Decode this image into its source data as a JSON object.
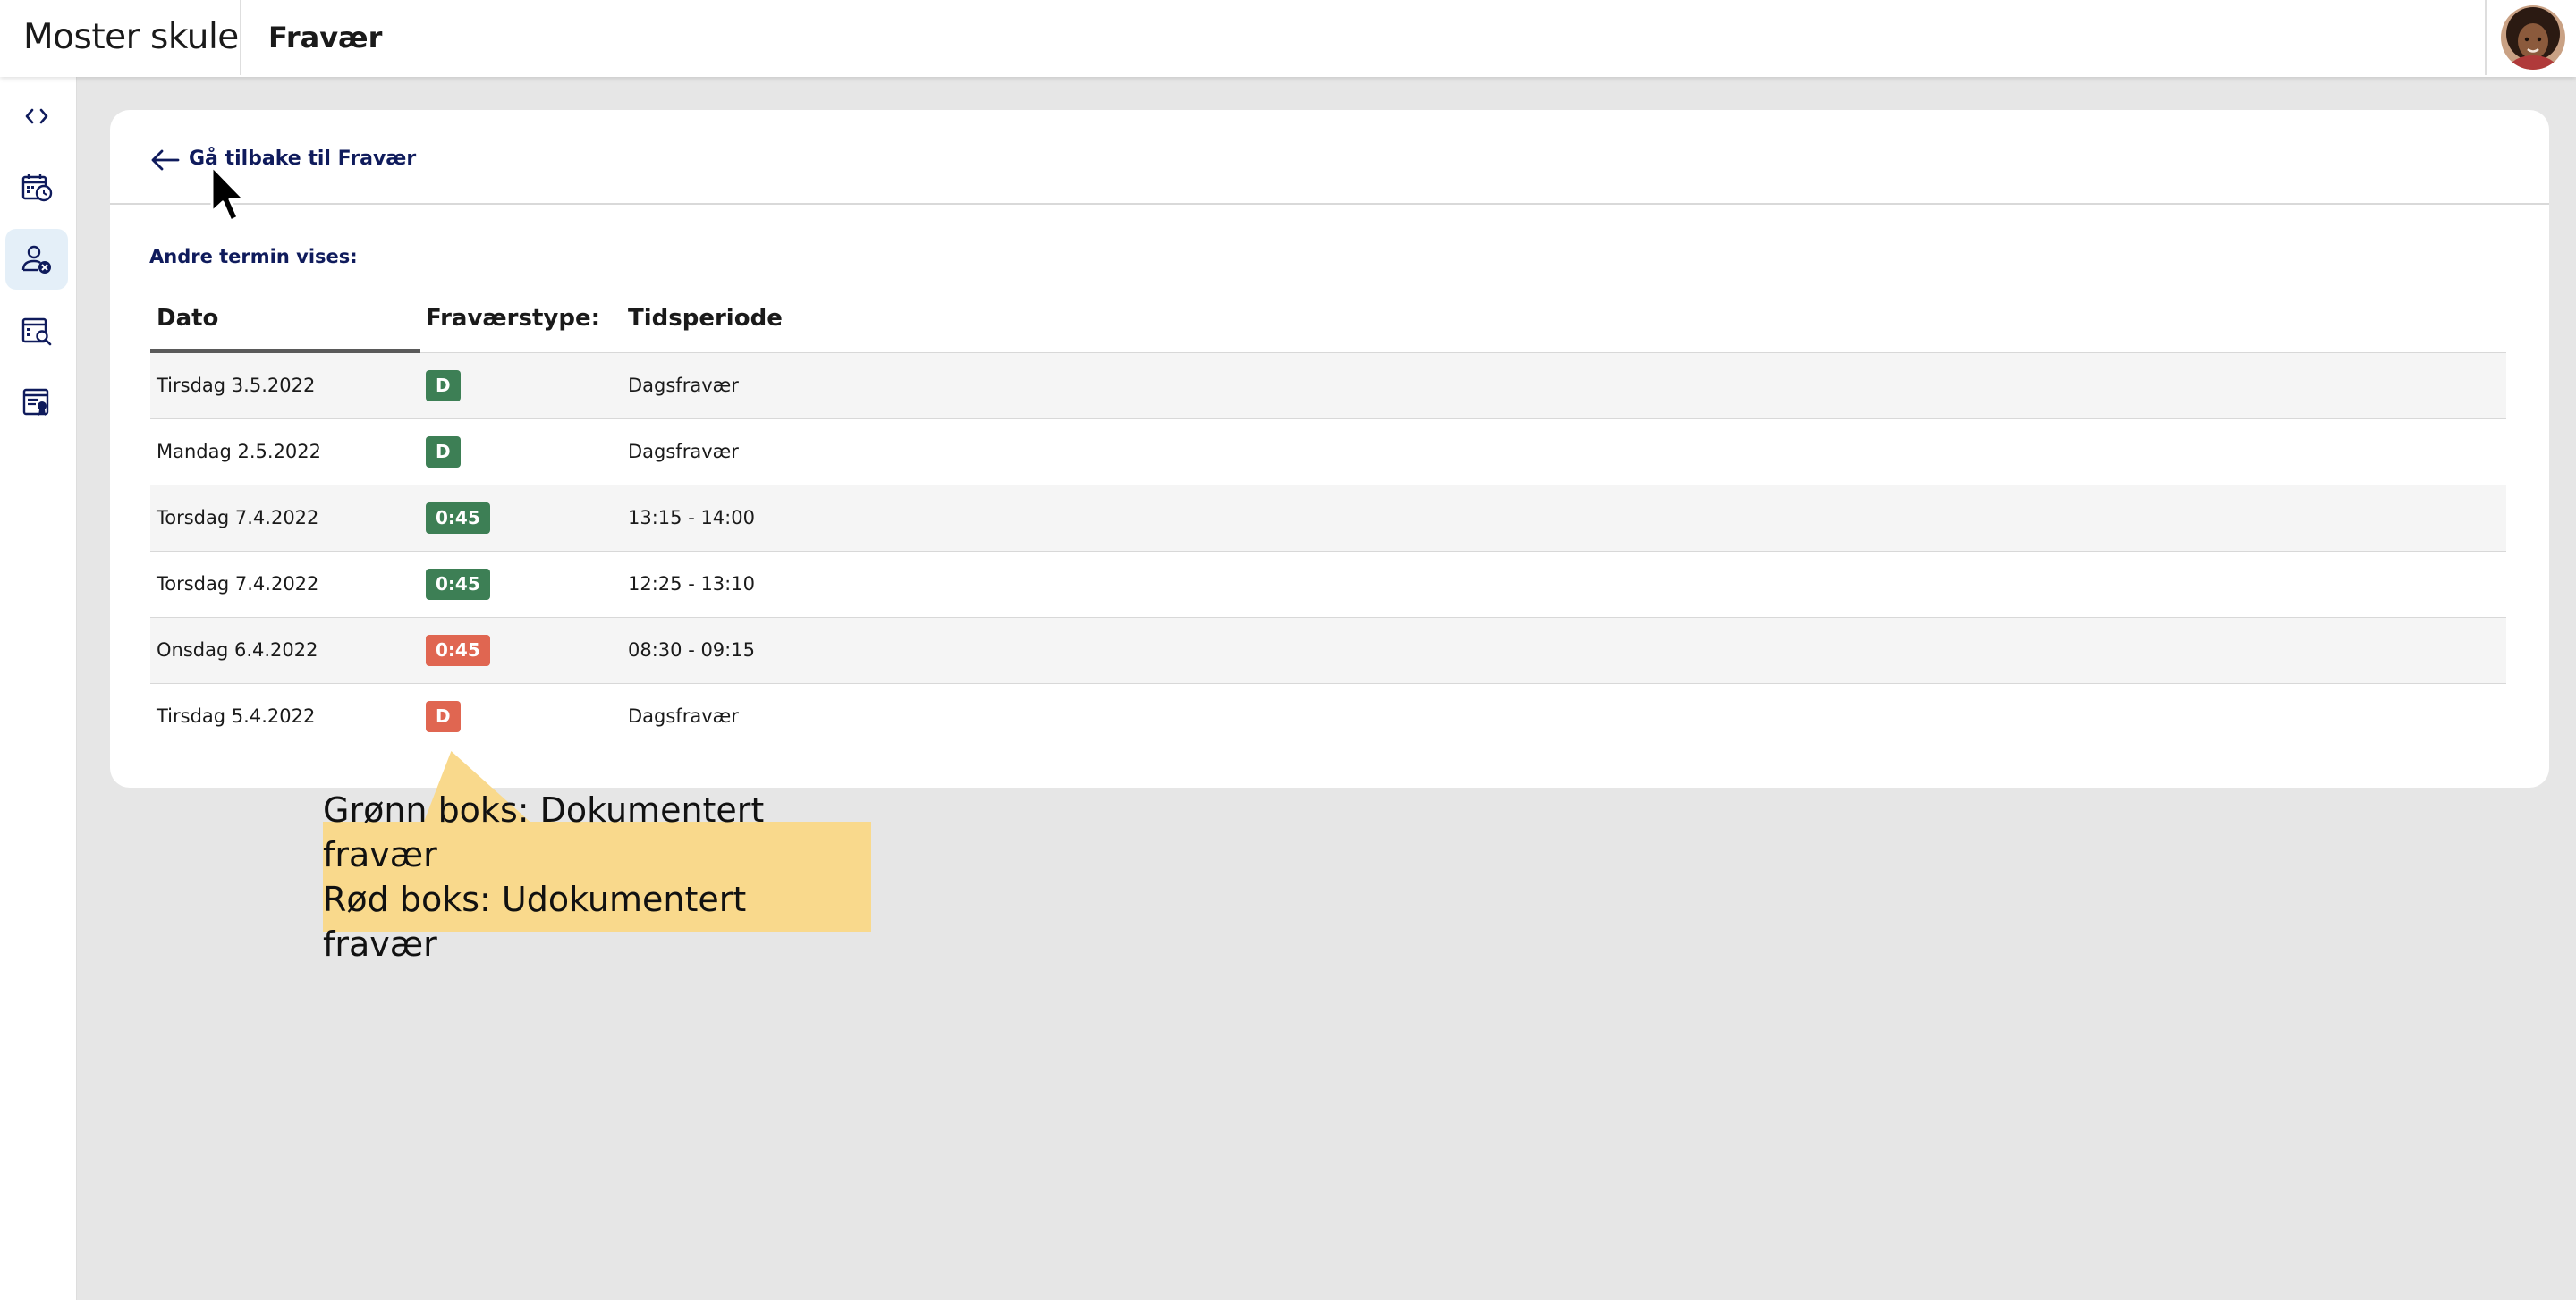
{
  "header": {
    "school_name": "Moster skule",
    "page_title": "Fravær"
  },
  "sidebar": {
    "items": [
      {
        "name": "collapse-toggle",
        "icon": "code-brackets-icon",
        "active": false
      },
      {
        "name": "schedule",
        "icon": "calendar-clock-icon",
        "active": false
      },
      {
        "name": "absence",
        "icon": "person-x-icon",
        "active": true
      },
      {
        "name": "grades",
        "icon": "document-search-icon",
        "active": false
      },
      {
        "name": "certificates",
        "icon": "list-badge-icon",
        "active": false
      }
    ]
  },
  "main": {
    "back_link": "Gå tilbake til Fravær",
    "term_label": "Andre termin vises:",
    "columns": {
      "date": "Dato",
      "type": "Fraværstype:",
      "period": "Tidsperiode"
    },
    "rows": [
      {
        "date": "Tirsdag 3.5.2022",
        "badge": "D",
        "status": "documented",
        "period": "Dagsfravær"
      },
      {
        "date": "Mandag 2.5.2022",
        "badge": "D",
        "status": "documented",
        "period": "Dagsfravær"
      },
      {
        "date": "Torsdag 7.4.2022",
        "badge": "0:45",
        "status": "documented",
        "period": "13:15 - 14:00"
      },
      {
        "date": "Torsdag 7.4.2022",
        "badge": "0:45",
        "status": "documented",
        "period": "12:25 - 13:10"
      },
      {
        "date": "Onsdag 6.4.2022",
        "badge": "0:45",
        "status": "undocumented",
        "period": "08:30 - 09:15"
      },
      {
        "date": "Tirsdag 5.4.2022",
        "badge": "D",
        "status": "undocumented",
        "period": "Dagsfravær"
      }
    ]
  },
  "tooltip": {
    "line1": "Grønn boks: Dokumentert fravær",
    "line2": "Rød boks: Udokumentert fravær"
  },
  "colors": {
    "documented": "#3d7f55",
    "undocumented": "#e06651",
    "link": "#0f1b5c",
    "tooltip": "#f9d98c",
    "sidebar_active": "#e4eff8"
  }
}
